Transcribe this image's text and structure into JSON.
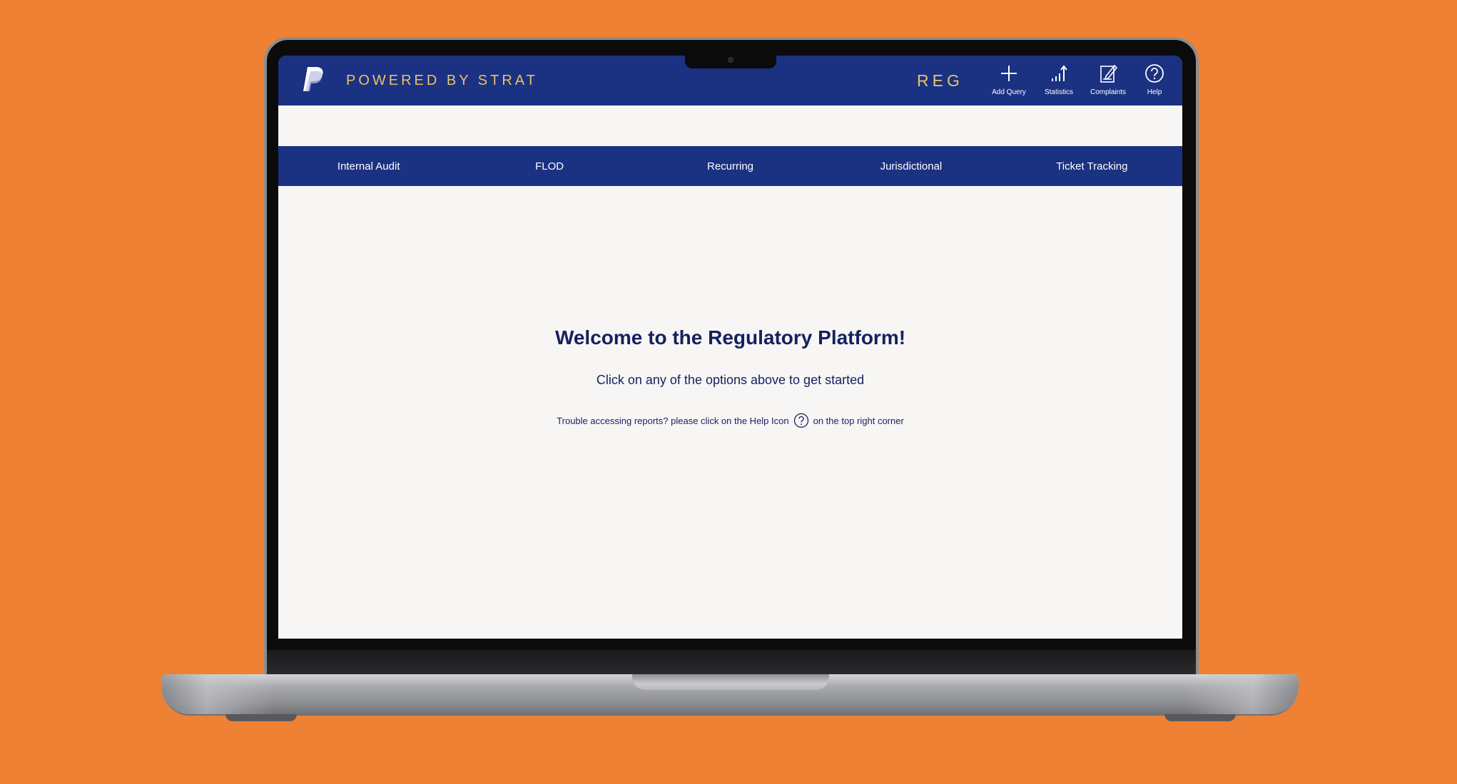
{
  "header": {
    "brand": "POWERED BY STRAT",
    "section": "REG",
    "actions": [
      {
        "label": "Add Query",
        "icon": "plus-icon"
      },
      {
        "label": "Statistics",
        "icon": "statistics-icon"
      },
      {
        "label": "Complaints",
        "icon": "complaints-icon"
      },
      {
        "label": "Help",
        "icon": "help-icon"
      }
    ]
  },
  "nav": {
    "items": [
      {
        "label": "Internal Audit"
      },
      {
        "label": "FLOD"
      },
      {
        "label": "Recurring"
      },
      {
        "label": "Jurisdictional"
      },
      {
        "label": "Ticket Tracking"
      }
    ]
  },
  "main": {
    "welcome": "Welcome to the Regulatory Platform!",
    "subtitle": "Click on any of the options above to get started",
    "trouble_prefix": "Trouble accessing reports? please click on the Help Icon",
    "trouble_suffix": "on the top right corner"
  },
  "colors": {
    "background": "#ee8133",
    "primary": "#1b3181",
    "accent": "#e8c36b",
    "text": "#15215f",
    "surface": "#f7f6f5"
  }
}
